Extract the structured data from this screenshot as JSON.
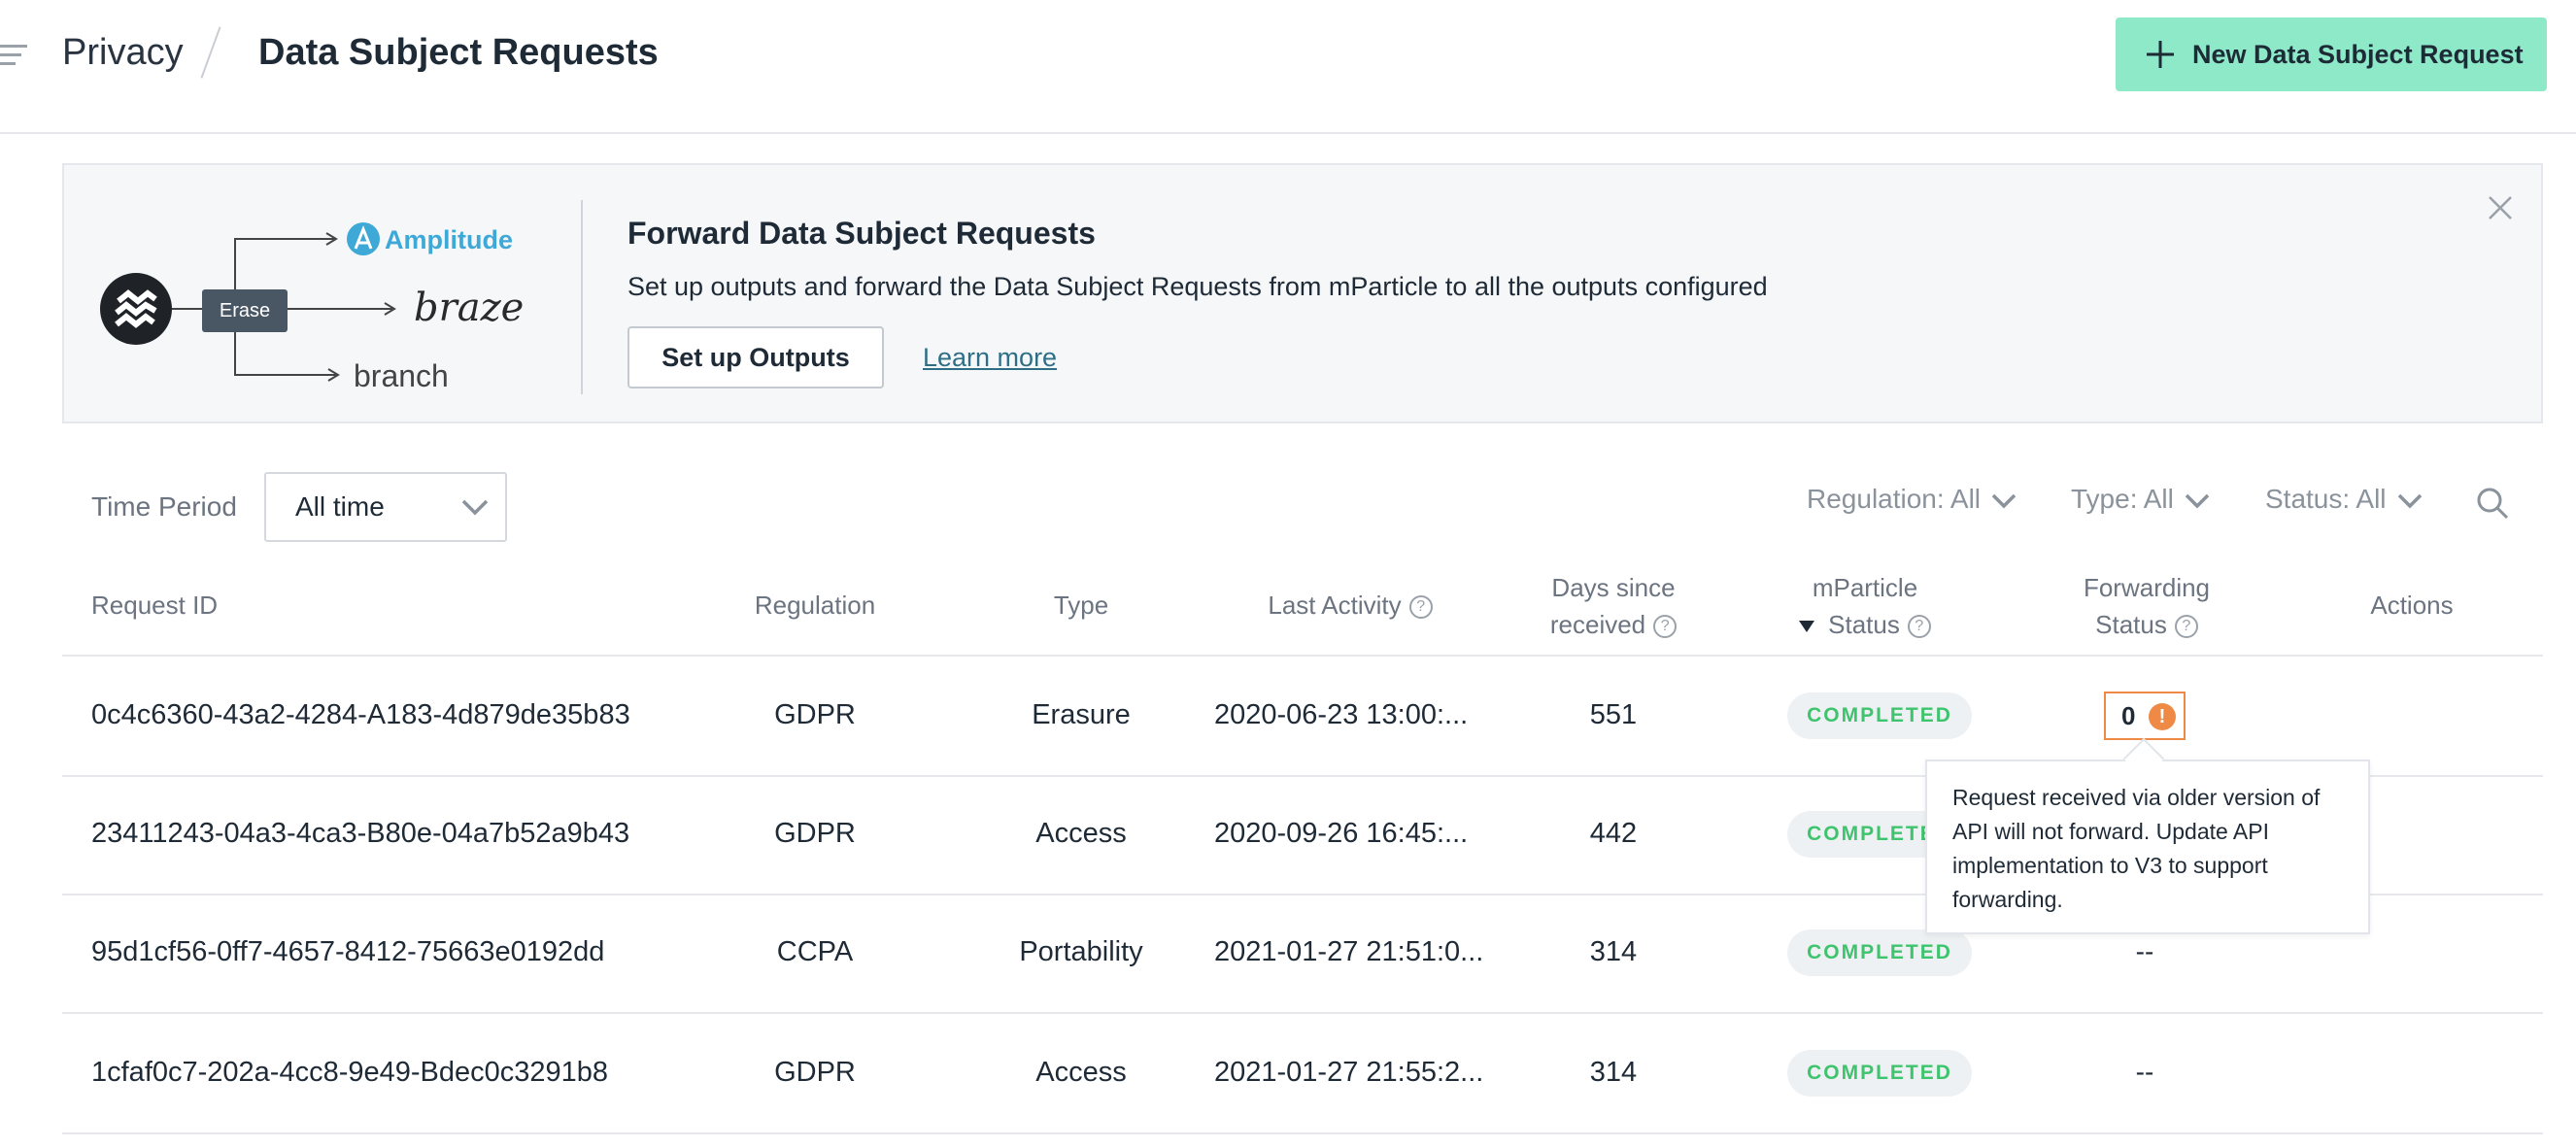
{
  "header": {
    "breadcrumb_root": "Privacy",
    "page_title": "Data Subject Requests",
    "new_button_label": "New Data Subject Request"
  },
  "banner": {
    "title": "Forward Data Subject Requests",
    "description": "Set up outputs and forward the Data Subject Requests from mParticle to all the outputs configured",
    "setup_button": "Set up Outputs",
    "learn_more": "Learn more",
    "illustration": {
      "erase_label": "Erase",
      "outputs": [
        "Amplitude",
        "braze",
        "branch"
      ]
    }
  },
  "filters": {
    "time_period_label": "Time Period",
    "time_period_value": "All time",
    "regulation": "Regulation: All",
    "type": "Type: All",
    "status": "Status: All"
  },
  "table": {
    "headers": {
      "request_id": "Request ID",
      "regulation": "Regulation",
      "type": "Type",
      "last_activity": "Last Activity",
      "days_line1": "Days since",
      "days_line2": "received",
      "mp_line1": "mParticle",
      "mp_line2": "Status",
      "fwd_line1": "Forwarding",
      "fwd_line2": "Status",
      "actions": "Actions"
    },
    "rows": [
      {
        "id": "0c4c6360-43a2-4284-A183-4d879de35b83",
        "regulation": "GDPR",
        "type": "Erasure",
        "last_activity": "2020-06-23 13:00:...",
        "days": "551",
        "status": "COMPLETED",
        "forwarding": "0"
      },
      {
        "id": "23411243-04a3-4ca3-B80e-04a7b52a9b43",
        "regulation": "GDPR",
        "type": "Access",
        "last_activity": "2020-09-26 16:45:...",
        "days": "442",
        "status": "COMPLETED",
        "forwarding": ""
      },
      {
        "id": "95d1cf56-0ff7-4657-8412-75663e0192dd",
        "regulation": "CCPA",
        "type": "Portability",
        "last_activity": "2021-01-27 21:51:0...",
        "days": "314",
        "status": "COMPLETED",
        "forwarding": "--"
      },
      {
        "id": "1cfaf0c7-202a-4cc8-9e49-Bdec0c3291b8",
        "regulation": "GDPR",
        "type": "Access",
        "last_activity": "2021-01-27 21:55:2...",
        "days": "314",
        "status": "COMPLETED",
        "forwarding": "--"
      }
    ]
  },
  "tooltip": {
    "text": "Request received via older version of API will not forward. Update API implementation to V3 to support forwarding."
  },
  "colors": {
    "accent": "#8ee9c9",
    "completed_text": "#3ec46d",
    "warning": "#ee8a46",
    "link": "#2f6f86"
  }
}
